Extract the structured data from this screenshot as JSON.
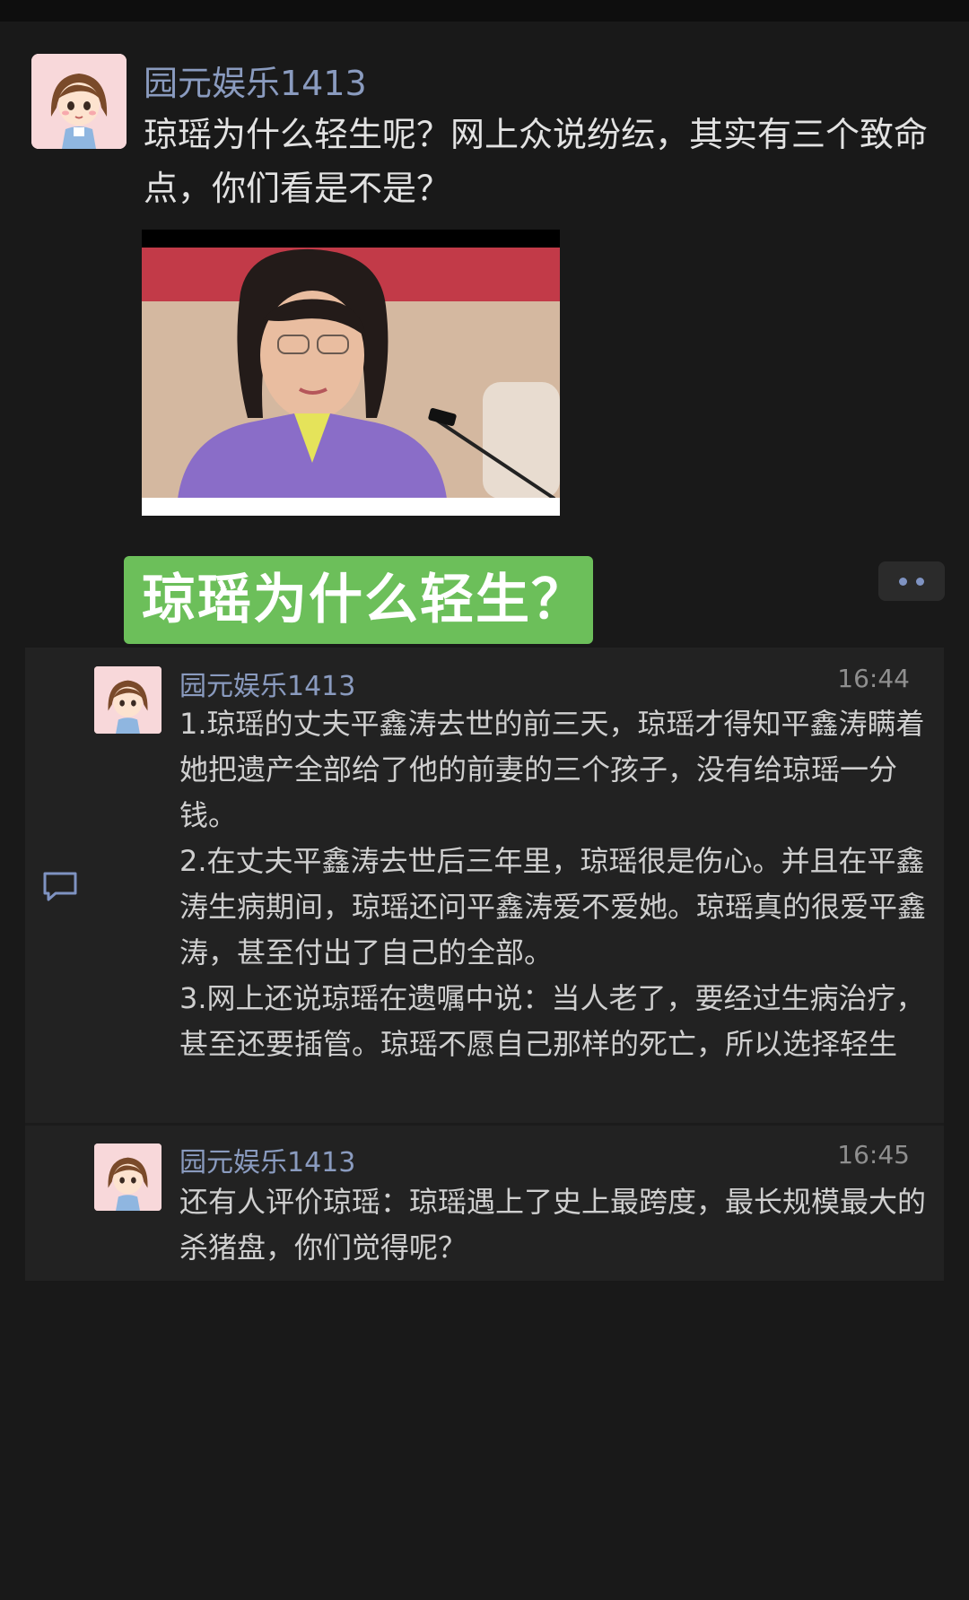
{
  "post": {
    "author": "园元娱乐1413",
    "text": "琼瑶为什么轻生呢？网上众说纷纭，其实有三个致命点，你们看是不是？",
    "image_overlay_text": "琼瑶为什么轻生？"
  },
  "comments": [
    {
      "author": "园元娱乐1413",
      "time": "16:44",
      "text": "1.琼瑶的丈夫平鑫涛去世的前三天，琼瑶才得知平鑫涛瞒着她把遗产全部给了他的前妻的三个孩子，没有给琼瑶一分钱。\n2.在丈夫平鑫涛去世后三年里，琼瑶很是伤心。并且在平鑫涛生病期间，琼瑶还问平鑫涛爱不爱她。琼瑶真的很爱平鑫涛，甚至付出了自己的全部。\n3.网上还说琼瑶在遗嘱中说：当人老了，要经过生病治疗，甚至还要插管。琼瑶不愿自己那样的死亡，所以选择轻生"
    },
    {
      "author": "园元娱乐1413",
      "time": "16:45",
      "text": "还有人评价琼瑶：琼瑶遇上了史上最跨度，最长规模最大的杀猪盘，你们觉得呢？"
    }
  ],
  "colors": {
    "background": "#191919",
    "name": "#8a9bbf",
    "banner": "#6cbf5a"
  },
  "icons": {
    "more": "more-dots-icon",
    "comment": "comment-bubble-icon"
  }
}
